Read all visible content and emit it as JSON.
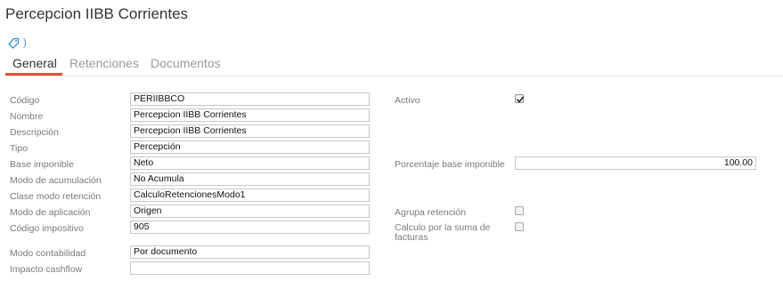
{
  "page": {
    "title": "Percepcion IIBB Corrientes"
  },
  "tabs": [
    {
      "label": "General",
      "active": true
    },
    {
      "label": "Retenciones",
      "active": false
    },
    {
      "label": "Documentos",
      "active": false
    }
  ],
  "form": {
    "codigo": {
      "label": "Código",
      "value": "PERIIBBCO"
    },
    "nombre": {
      "label": "Nombre",
      "value": "Percepcion IIBB Corrientes"
    },
    "descripcion": {
      "label": "Descripción",
      "value": "Percepcion IIBB Corrientes"
    },
    "tipo": {
      "label": "Tipo",
      "value": "Percepción"
    },
    "base_imponible": {
      "label": "Base imponible",
      "value": "Neto"
    },
    "modo_acumulacion": {
      "label": "Modo de acumulación",
      "value": "No Acumula"
    },
    "clase_modo_retencion": {
      "label": "Clase modo retención",
      "value": "CalculoRetencionesModo1"
    },
    "modo_aplicacion": {
      "label": "Modo de aplicación",
      "value": "Origen"
    },
    "codigo_impositivo": {
      "label": "Código impositivo",
      "value": "905"
    },
    "modo_contabilidad": {
      "label": "Modo contabilidad",
      "value": "Por documento"
    },
    "impacto_cashflow": {
      "label": "Impacto cashflow",
      "value": ""
    },
    "activo": {
      "label": "Activo",
      "checked": true
    },
    "porcentaje_base_imponible": {
      "label": "Porcentaje base imponible",
      "value": "100.00"
    },
    "agrupa_retencion": {
      "label": "Agrupa retención",
      "checked": false
    },
    "calculo_suma_facturas": {
      "label": "Calculo por la suma de facturas",
      "checked": false
    }
  },
  "icons": {
    "tag": "tag-icon",
    "chevron": "chevron-right-icon"
  },
  "colors": {
    "accent": "#e0533d",
    "link": "#3a8fd8"
  }
}
